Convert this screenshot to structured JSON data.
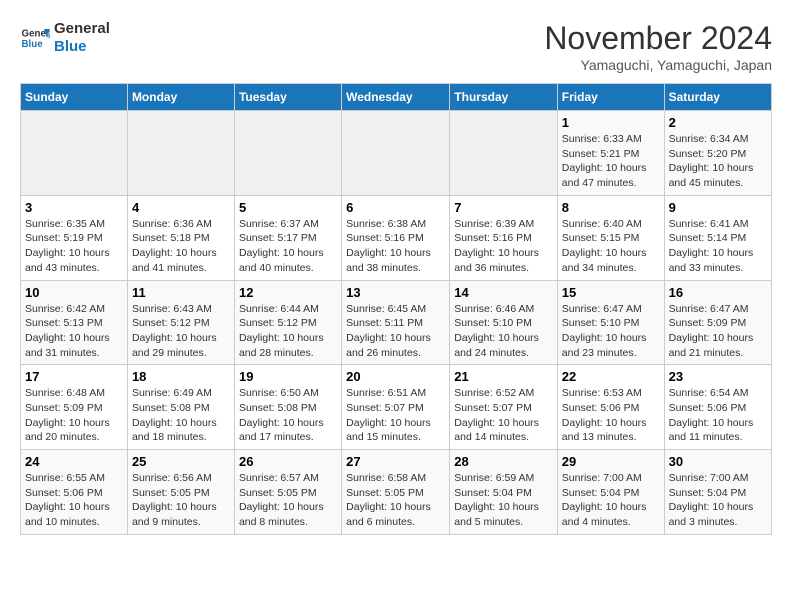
{
  "header": {
    "logo_line1": "General",
    "logo_line2": "Blue",
    "title": "November 2024",
    "subtitle": "Yamaguchi, Yamaguchi, Japan"
  },
  "days_of_week": [
    "Sunday",
    "Monday",
    "Tuesday",
    "Wednesday",
    "Thursday",
    "Friday",
    "Saturday"
  ],
  "weeks": [
    [
      {
        "day": "",
        "info": ""
      },
      {
        "day": "",
        "info": ""
      },
      {
        "day": "",
        "info": ""
      },
      {
        "day": "",
        "info": ""
      },
      {
        "day": "",
        "info": ""
      },
      {
        "day": "1",
        "info": "Sunrise: 6:33 AM\nSunset: 5:21 PM\nDaylight: 10 hours and 47 minutes."
      },
      {
        "day": "2",
        "info": "Sunrise: 6:34 AM\nSunset: 5:20 PM\nDaylight: 10 hours and 45 minutes."
      }
    ],
    [
      {
        "day": "3",
        "info": "Sunrise: 6:35 AM\nSunset: 5:19 PM\nDaylight: 10 hours and 43 minutes."
      },
      {
        "day": "4",
        "info": "Sunrise: 6:36 AM\nSunset: 5:18 PM\nDaylight: 10 hours and 41 minutes."
      },
      {
        "day": "5",
        "info": "Sunrise: 6:37 AM\nSunset: 5:17 PM\nDaylight: 10 hours and 40 minutes."
      },
      {
        "day": "6",
        "info": "Sunrise: 6:38 AM\nSunset: 5:16 PM\nDaylight: 10 hours and 38 minutes."
      },
      {
        "day": "7",
        "info": "Sunrise: 6:39 AM\nSunset: 5:16 PM\nDaylight: 10 hours and 36 minutes."
      },
      {
        "day": "8",
        "info": "Sunrise: 6:40 AM\nSunset: 5:15 PM\nDaylight: 10 hours and 34 minutes."
      },
      {
        "day": "9",
        "info": "Sunrise: 6:41 AM\nSunset: 5:14 PM\nDaylight: 10 hours and 33 minutes."
      }
    ],
    [
      {
        "day": "10",
        "info": "Sunrise: 6:42 AM\nSunset: 5:13 PM\nDaylight: 10 hours and 31 minutes."
      },
      {
        "day": "11",
        "info": "Sunrise: 6:43 AM\nSunset: 5:12 PM\nDaylight: 10 hours and 29 minutes."
      },
      {
        "day": "12",
        "info": "Sunrise: 6:44 AM\nSunset: 5:12 PM\nDaylight: 10 hours and 28 minutes."
      },
      {
        "day": "13",
        "info": "Sunrise: 6:45 AM\nSunset: 5:11 PM\nDaylight: 10 hours and 26 minutes."
      },
      {
        "day": "14",
        "info": "Sunrise: 6:46 AM\nSunset: 5:10 PM\nDaylight: 10 hours and 24 minutes."
      },
      {
        "day": "15",
        "info": "Sunrise: 6:47 AM\nSunset: 5:10 PM\nDaylight: 10 hours and 23 minutes."
      },
      {
        "day": "16",
        "info": "Sunrise: 6:47 AM\nSunset: 5:09 PM\nDaylight: 10 hours and 21 minutes."
      }
    ],
    [
      {
        "day": "17",
        "info": "Sunrise: 6:48 AM\nSunset: 5:09 PM\nDaylight: 10 hours and 20 minutes."
      },
      {
        "day": "18",
        "info": "Sunrise: 6:49 AM\nSunset: 5:08 PM\nDaylight: 10 hours and 18 minutes."
      },
      {
        "day": "19",
        "info": "Sunrise: 6:50 AM\nSunset: 5:08 PM\nDaylight: 10 hours and 17 minutes."
      },
      {
        "day": "20",
        "info": "Sunrise: 6:51 AM\nSunset: 5:07 PM\nDaylight: 10 hours and 15 minutes."
      },
      {
        "day": "21",
        "info": "Sunrise: 6:52 AM\nSunset: 5:07 PM\nDaylight: 10 hours and 14 minutes."
      },
      {
        "day": "22",
        "info": "Sunrise: 6:53 AM\nSunset: 5:06 PM\nDaylight: 10 hours and 13 minutes."
      },
      {
        "day": "23",
        "info": "Sunrise: 6:54 AM\nSunset: 5:06 PM\nDaylight: 10 hours and 11 minutes."
      }
    ],
    [
      {
        "day": "24",
        "info": "Sunrise: 6:55 AM\nSunset: 5:06 PM\nDaylight: 10 hours and 10 minutes."
      },
      {
        "day": "25",
        "info": "Sunrise: 6:56 AM\nSunset: 5:05 PM\nDaylight: 10 hours and 9 minutes."
      },
      {
        "day": "26",
        "info": "Sunrise: 6:57 AM\nSunset: 5:05 PM\nDaylight: 10 hours and 8 minutes."
      },
      {
        "day": "27",
        "info": "Sunrise: 6:58 AM\nSunset: 5:05 PM\nDaylight: 10 hours and 6 minutes."
      },
      {
        "day": "28",
        "info": "Sunrise: 6:59 AM\nSunset: 5:04 PM\nDaylight: 10 hours and 5 minutes."
      },
      {
        "day": "29",
        "info": "Sunrise: 7:00 AM\nSunset: 5:04 PM\nDaylight: 10 hours and 4 minutes."
      },
      {
        "day": "30",
        "info": "Sunrise: 7:00 AM\nSunset: 5:04 PM\nDaylight: 10 hours and 3 minutes."
      }
    ]
  ]
}
